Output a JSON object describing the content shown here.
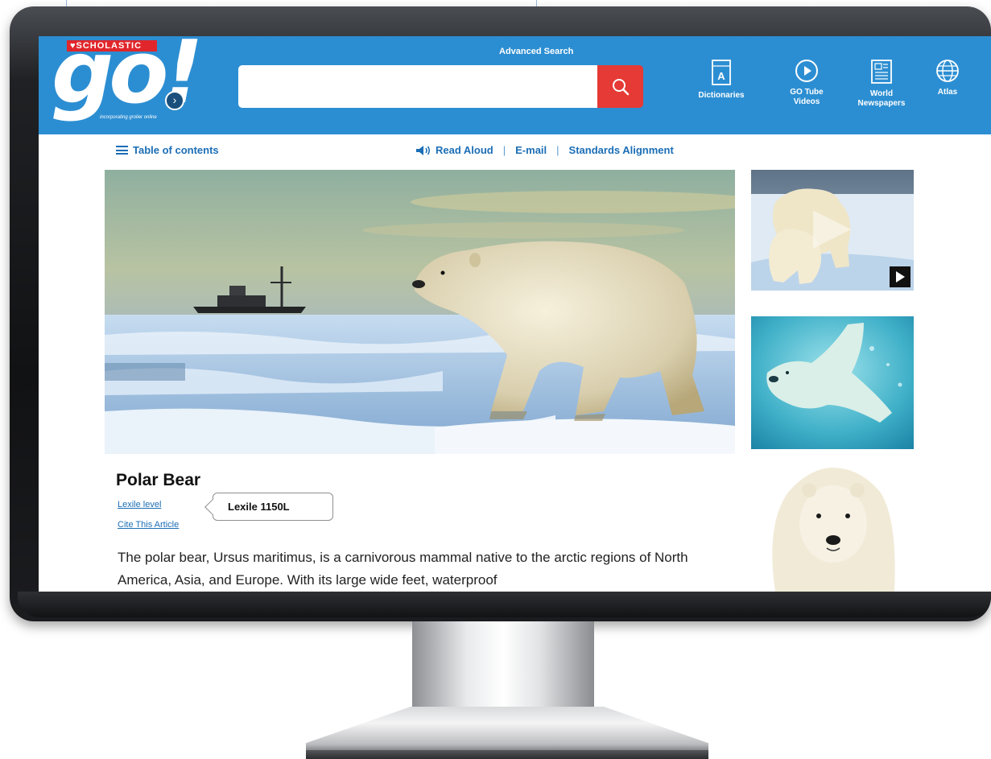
{
  "header": {
    "brand_tag": "SCHOLASTIC",
    "logo_text": "go!",
    "logo_subtitle": "incorporating grolier online",
    "advanced_search": "Advanced Search",
    "search_value": "",
    "nav": [
      {
        "label": "Dictionaries",
        "icon": "dictionary-icon"
      },
      {
        "label": "GO Tube Videos",
        "icon": "play-circle-icon"
      },
      {
        "label": "World Newspapers",
        "icon": "newspaper-icon"
      },
      {
        "label": "Atlas",
        "icon": "globe-icon"
      }
    ]
  },
  "toolbar": {
    "toc": "Table of contents",
    "read_aloud": "Read Aloud",
    "email": "E-mail",
    "standards": "Standards Alignment",
    "separator": "|"
  },
  "article": {
    "title": "Polar Bear",
    "lexile_link": "Lexile level",
    "lexile_value": "Lexile 1150L",
    "cite": "Cite This Article",
    "body": "The polar bear, Ursus maritimus, is a carnivorous mammal native to the arctic regions of North America, Asia, and Europe. With its large wide feet, waterproof"
  },
  "colors": {
    "header_blue": "#2c8ed2",
    "search_red": "#e53a35",
    "link_blue": "#1b6eb6",
    "brand_red": "#e1262b"
  }
}
